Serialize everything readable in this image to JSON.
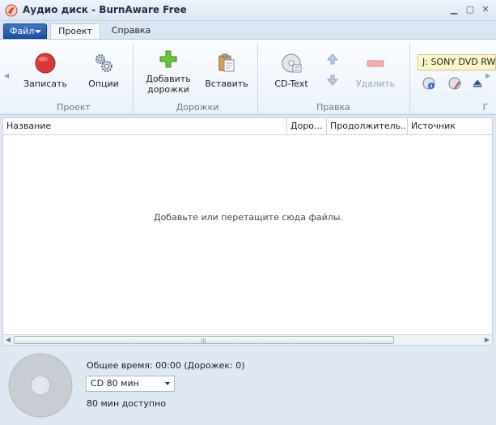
{
  "window": {
    "title": "Аудио диск - BurnAware Free"
  },
  "menu": {
    "file": "Файл",
    "tabs": [
      "Проект",
      "Справка"
    ]
  },
  "ribbon": {
    "groups": {
      "project": "Проект",
      "tracks": "Дорожки",
      "edit": "Правка",
      "drive": "Г"
    },
    "buttons": {
      "burn": "Записать",
      "options": "Опции",
      "add_tracks_line1": "Добавить",
      "add_tracks_line2": "дорожки",
      "paste": "Вставить",
      "cd_text": "CD-Text",
      "delete": "Удалить"
    },
    "drive": "J: SONY DVD RW"
  },
  "list": {
    "columns": [
      "Название",
      "Доро...",
      "Продолжитель...",
      "Источник"
    ],
    "empty_message": "Добавьте или перетащите сюда файлы."
  },
  "status": {
    "total_time": "Общее время: 00:00 (Дорожек: 0)",
    "disc_type": "CD 80 мин",
    "available": "80 мин доступно"
  },
  "colors": {
    "accent": "#2a5db0",
    "burn_red": "#d83a3a",
    "add_green": "#5cb82a"
  }
}
